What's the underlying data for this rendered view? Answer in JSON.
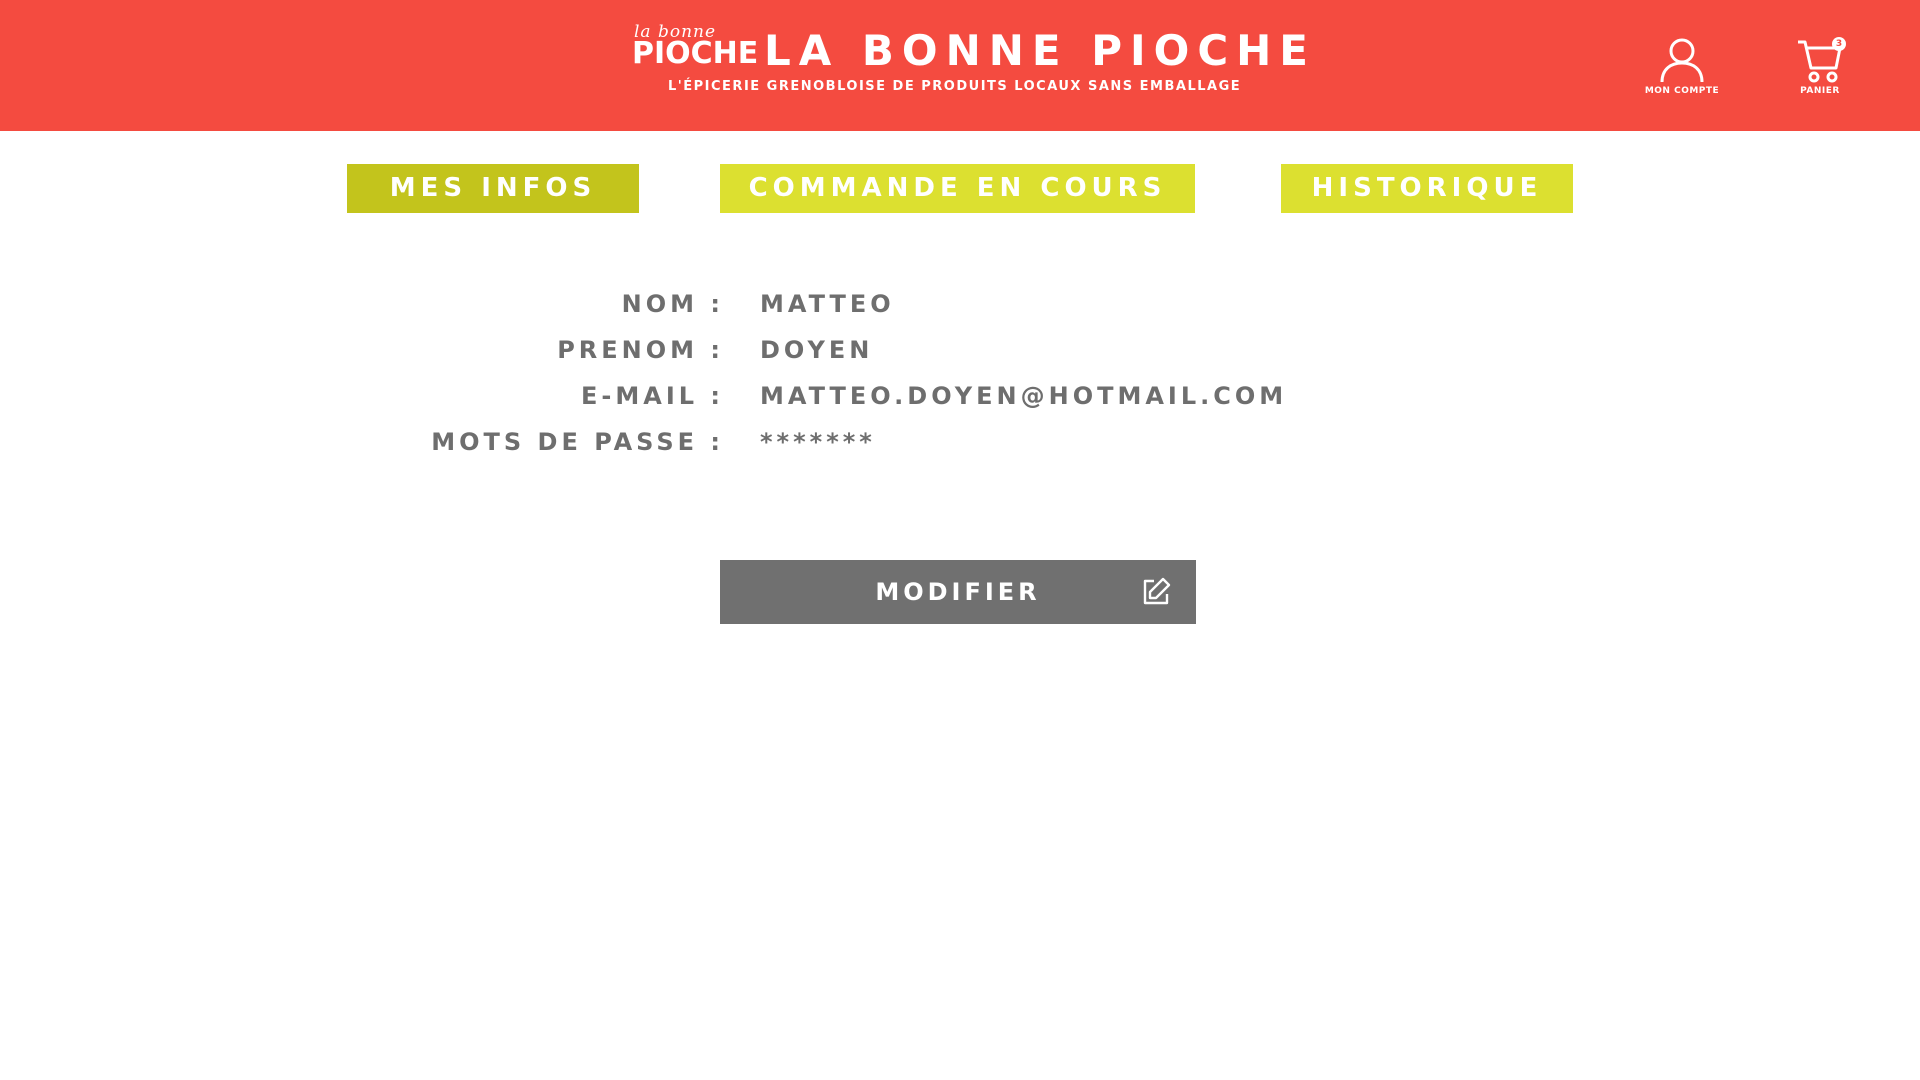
{
  "header": {
    "logo_small": "la bonne",
    "logo_big": "PIOCHE",
    "title": "LA BONNE PIOCHE",
    "subtitle": "L'ÉPICERIE GRENOBLOISE DE PRODUITS LOCAUX SANS EMBALLAGE",
    "account_label": "MON COMPTE",
    "account_icon": "user-icon",
    "cart_label": "PANIER",
    "cart_icon": "cart-icon",
    "cart_count": "3"
  },
  "tabs": [
    {
      "label": "MES INFOS",
      "active": true
    },
    {
      "label": "COMMANDE EN COURS",
      "active": false
    },
    {
      "label": "HISTORIQUE",
      "active": false
    }
  ],
  "profile": {
    "rows": [
      {
        "label": "NOM :",
        "value": "MATTEO"
      },
      {
        "label": "PRENOM :",
        "value": "DOYEN"
      },
      {
        "label": "E-MAIL :",
        "value": "MATTEO.DOYEN@HOTMAIL.COM"
      },
      {
        "label": "MOTS DE PASSE :",
        "value": "*******"
      }
    ]
  },
  "actions": {
    "modify_label": "MODIFIER",
    "modify_icon": "edit-icon"
  },
  "colors": {
    "header_bg": "#f44b40",
    "tab_active": "#c3c41c",
    "tab_idle": "#dce030",
    "text_grey": "#6e6e6e",
    "button_bg": "#707070"
  }
}
